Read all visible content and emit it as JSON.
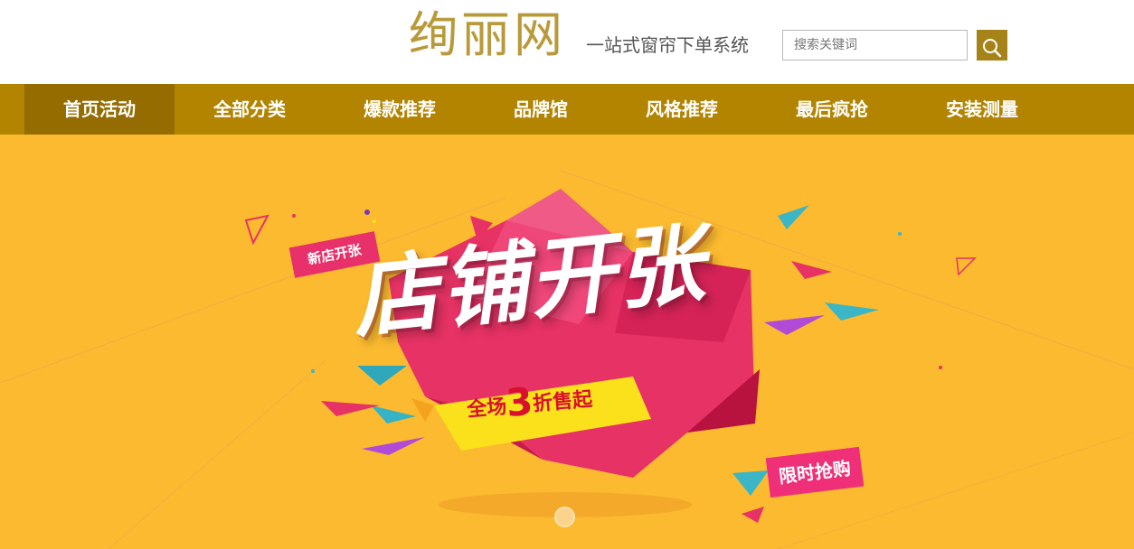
{
  "header": {
    "logo": "绚丽网",
    "slogan": "一站式窗帘下单系统",
    "search_placeholder": "搜索关键词",
    "search_icon": "magnifier-icon"
  },
  "nav": {
    "items": [
      {
        "label": "首页活动",
        "active": true
      },
      {
        "label": "全部分类",
        "active": false
      },
      {
        "label": "爆款推荐",
        "active": false
      },
      {
        "label": "品牌馆",
        "active": false
      },
      {
        "label": "风格推荐",
        "active": false
      },
      {
        "label": "最后疯抢",
        "active": false
      },
      {
        "label": "安装测量",
        "active": false
      }
    ]
  },
  "banner": {
    "tag_new": "新店开张",
    "headline": "店铺开张",
    "discount_prefix": "全场",
    "discount_number": "3",
    "discount_suffix": "折售起",
    "tag_limited": "限时抢购",
    "slides_total": 1,
    "slide_active": 1
  },
  "colors": {
    "logo": "#b99a3a",
    "nav_bg": "#b28400",
    "nav_active": "#946c00",
    "banner_bg": "#fbba2f",
    "accent_pink": "#e8306a",
    "accent_red": "#d8102e",
    "search_button": "#a68319"
  }
}
